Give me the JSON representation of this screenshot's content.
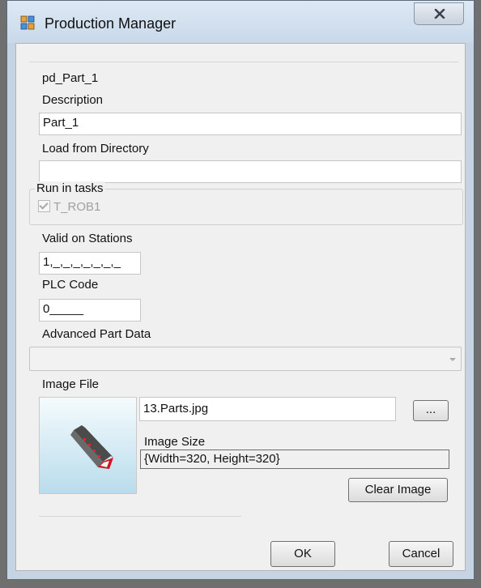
{
  "window": {
    "title": "Production Manager",
    "icons": {
      "app": "production-manager-app-icon",
      "close": "close-x-icon"
    }
  },
  "form": {
    "part_name": "pd_Part_1",
    "description_label": "Description",
    "description_value": "Part_1",
    "load_dir_label": "Load from Directory",
    "load_dir_value": "",
    "run_in_tasks_label": "Run in tasks",
    "task_item": "T_ROB1",
    "task_item_checked": true,
    "valid_stations_label": "Valid on Stations",
    "valid_stations_value": "1,_,_,_,_,_,_,_",
    "plc_code_label": "PLC Code",
    "plc_code_value": "0_____",
    "advanced_part_label": "Advanced Part Data",
    "advanced_part_value": "",
    "image_file_label": "Image File",
    "image_file_value": "13.Parts.jpg",
    "browse_label": "...",
    "image_size_label": "Image Size",
    "image_size_value": "{Width=320, Height=320}",
    "clear_image_label": "Clear Image"
  },
  "footer": {
    "ok_label": "OK",
    "cancel_label": "Cancel"
  },
  "colors": {
    "titlebar": "#c9d9ea",
    "client_bg": "#f0f0f0",
    "part_accent": "#d4111a"
  }
}
